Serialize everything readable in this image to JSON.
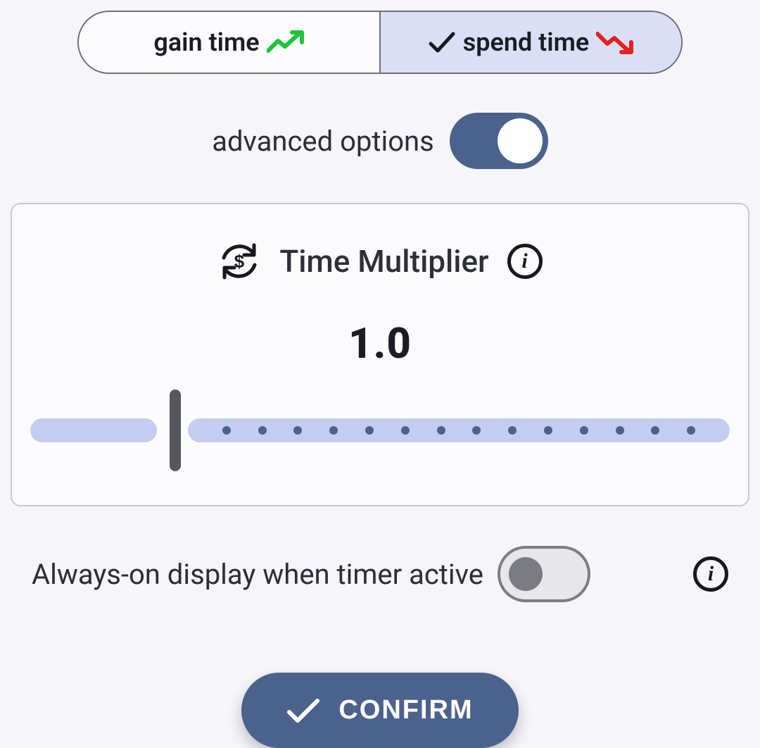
{
  "segmented": {
    "gain_label": "gain time",
    "spend_label": "spend time",
    "selected": "spend"
  },
  "advanced": {
    "label": "advanced options",
    "enabled": true
  },
  "multiplier": {
    "title": "Time Multiplier",
    "value": "1.0",
    "ticks": 14
  },
  "always_on": {
    "label": "Always-on display when timer active",
    "enabled": false
  },
  "confirm": {
    "label": "CONFIRM"
  },
  "colors": {
    "accent": "#4a628c",
    "slider_track": "#c4cdf0",
    "green": "#1dc43c",
    "red": "#e62020"
  }
}
